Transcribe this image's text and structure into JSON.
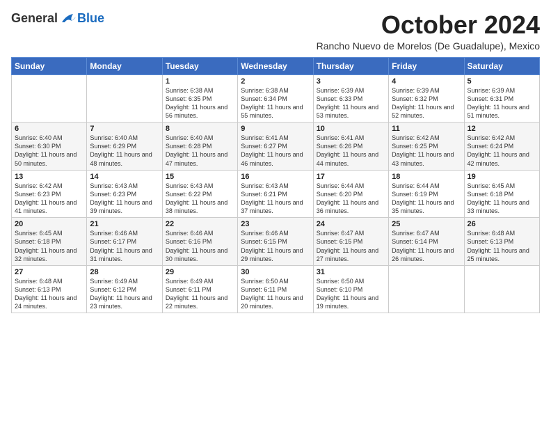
{
  "logo": {
    "general": "General",
    "blue": "Blue"
  },
  "title": "October 2024",
  "subtitle": "Rancho Nuevo de Morelos (De Guadalupe), Mexico",
  "days_header": [
    "Sunday",
    "Monday",
    "Tuesday",
    "Wednesday",
    "Thursday",
    "Friday",
    "Saturday"
  ],
  "weeks": [
    [
      {
        "day": "",
        "info": ""
      },
      {
        "day": "",
        "info": ""
      },
      {
        "day": "1",
        "info": "Sunrise: 6:38 AM\nSunset: 6:35 PM\nDaylight: 11 hours and 56 minutes."
      },
      {
        "day": "2",
        "info": "Sunrise: 6:38 AM\nSunset: 6:34 PM\nDaylight: 11 hours and 55 minutes."
      },
      {
        "day": "3",
        "info": "Sunrise: 6:39 AM\nSunset: 6:33 PM\nDaylight: 11 hours and 53 minutes."
      },
      {
        "day": "4",
        "info": "Sunrise: 6:39 AM\nSunset: 6:32 PM\nDaylight: 11 hours and 52 minutes."
      },
      {
        "day": "5",
        "info": "Sunrise: 6:39 AM\nSunset: 6:31 PM\nDaylight: 11 hours and 51 minutes."
      }
    ],
    [
      {
        "day": "6",
        "info": "Sunrise: 6:40 AM\nSunset: 6:30 PM\nDaylight: 11 hours and 50 minutes."
      },
      {
        "day": "7",
        "info": "Sunrise: 6:40 AM\nSunset: 6:29 PM\nDaylight: 11 hours and 48 minutes."
      },
      {
        "day": "8",
        "info": "Sunrise: 6:40 AM\nSunset: 6:28 PM\nDaylight: 11 hours and 47 minutes."
      },
      {
        "day": "9",
        "info": "Sunrise: 6:41 AM\nSunset: 6:27 PM\nDaylight: 11 hours and 46 minutes."
      },
      {
        "day": "10",
        "info": "Sunrise: 6:41 AM\nSunset: 6:26 PM\nDaylight: 11 hours and 44 minutes."
      },
      {
        "day": "11",
        "info": "Sunrise: 6:42 AM\nSunset: 6:25 PM\nDaylight: 11 hours and 43 minutes."
      },
      {
        "day": "12",
        "info": "Sunrise: 6:42 AM\nSunset: 6:24 PM\nDaylight: 11 hours and 42 minutes."
      }
    ],
    [
      {
        "day": "13",
        "info": "Sunrise: 6:42 AM\nSunset: 6:23 PM\nDaylight: 11 hours and 41 minutes."
      },
      {
        "day": "14",
        "info": "Sunrise: 6:43 AM\nSunset: 6:23 PM\nDaylight: 11 hours and 39 minutes."
      },
      {
        "day": "15",
        "info": "Sunrise: 6:43 AM\nSunset: 6:22 PM\nDaylight: 11 hours and 38 minutes."
      },
      {
        "day": "16",
        "info": "Sunrise: 6:43 AM\nSunset: 6:21 PM\nDaylight: 11 hours and 37 minutes."
      },
      {
        "day": "17",
        "info": "Sunrise: 6:44 AM\nSunset: 6:20 PM\nDaylight: 11 hours and 36 minutes."
      },
      {
        "day": "18",
        "info": "Sunrise: 6:44 AM\nSunset: 6:19 PM\nDaylight: 11 hours and 35 minutes."
      },
      {
        "day": "19",
        "info": "Sunrise: 6:45 AM\nSunset: 6:18 PM\nDaylight: 11 hours and 33 minutes."
      }
    ],
    [
      {
        "day": "20",
        "info": "Sunrise: 6:45 AM\nSunset: 6:18 PM\nDaylight: 11 hours and 32 minutes."
      },
      {
        "day": "21",
        "info": "Sunrise: 6:46 AM\nSunset: 6:17 PM\nDaylight: 11 hours and 31 minutes."
      },
      {
        "day": "22",
        "info": "Sunrise: 6:46 AM\nSunset: 6:16 PM\nDaylight: 11 hours and 30 minutes."
      },
      {
        "day": "23",
        "info": "Sunrise: 6:46 AM\nSunset: 6:15 PM\nDaylight: 11 hours and 29 minutes."
      },
      {
        "day": "24",
        "info": "Sunrise: 6:47 AM\nSunset: 6:15 PM\nDaylight: 11 hours and 27 minutes."
      },
      {
        "day": "25",
        "info": "Sunrise: 6:47 AM\nSunset: 6:14 PM\nDaylight: 11 hours and 26 minutes."
      },
      {
        "day": "26",
        "info": "Sunrise: 6:48 AM\nSunset: 6:13 PM\nDaylight: 11 hours and 25 minutes."
      }
    ],
    [
      {
        "day": "27",
        "info": "Sunrise: 6:48 AM\nSunset: 6:13 PM\nDaylight: 11 hours and 24 minutes."
      },
      {
        "day": "28",
        "info": "Sunrise: 6:49 AM\nSunset: 6:12 PM\nDaylight: 11 hours and 23 minutes."
      },
      {
        "day": "29",
        "info": "Sunrise: 6:49 AM\nSunset: 6:11 PM\nDaylight: 11 hours and 22 minutes."
      },
      {
        "day": "30",
        "info": "Sunrise: 6:50 AM\nSunset: 6:11 PM\nDaylight: 11 hours and 20 minutes."
      },
      {
        "day": "31",
        "info": "Sunrise: 6:50 AM\nSunset: 6:10 PM\nDaylight: 11 hours and 19 minutes."
      },
      {
        "day": "",
        "info": ""
      },
      {
        "day": "",
        "info": ""
      }
    ]
  ]
}
